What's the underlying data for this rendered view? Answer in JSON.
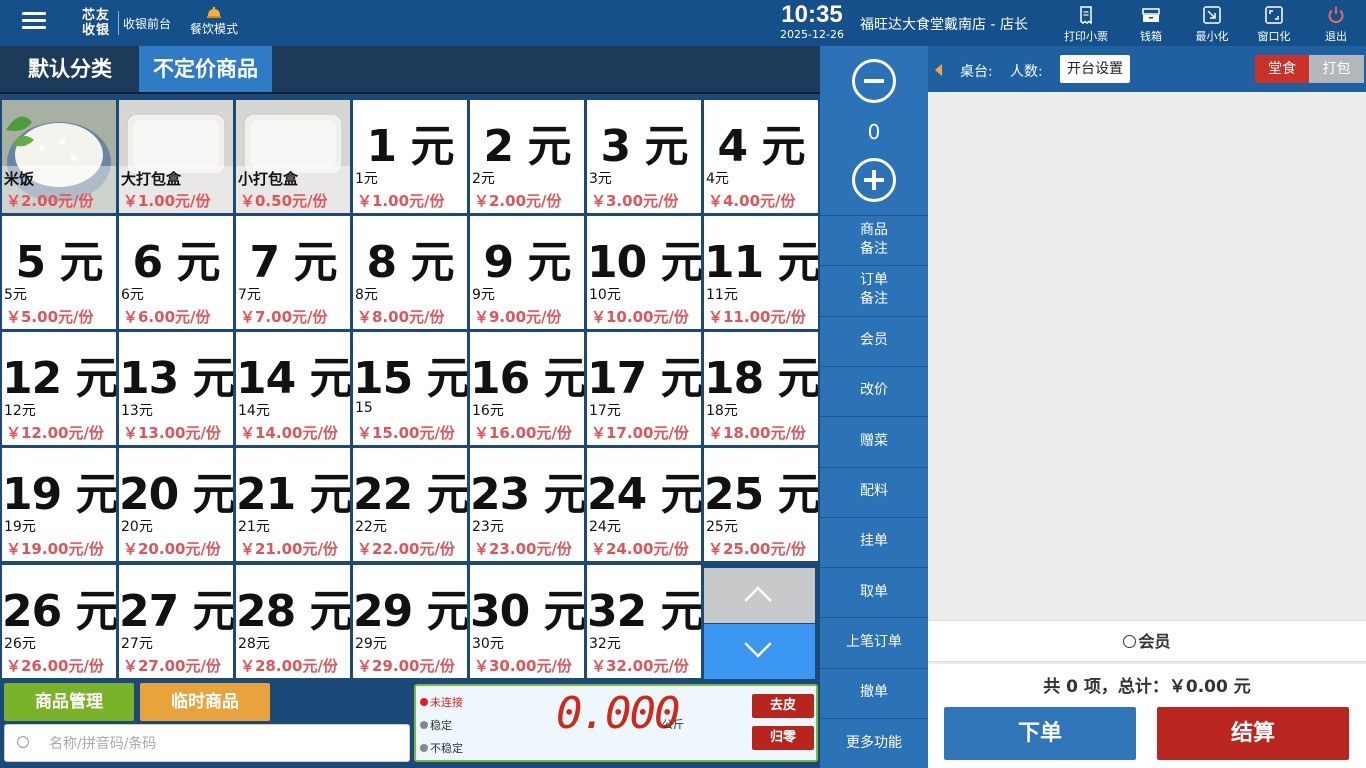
{
  "topbar": {
    "logo_line1": "芯友",
    "logo_line2": "收银",
    "logo_sub": "收银前台",
    "mode_label": "餐饮模式",
    "time": "10:35",
    "date": "2025-12-26",
    "store_name": "福旺达大食堂戴南店 - 店长",
    "buttons": [
      {
        "label": "打印小票",
        "icon": "receipt-icon"
      },
      {
        "label": "钱箱",
        "icon": "cash-drawer-icon"
      },
      {
        "label": "最小化",
        "icon": "minimize-icon"
      },
      {
        "label": "窗口化",
        "icon": "window-icon"
      },
      {
        "label": "退出",
        "icon": "power-icon"
      }
    ]
  },
  "categories": [
    {
      "label": "默认分类",
      "active": false
    },
    {
      "label": "不定价商品",
      "active": true
    }
  ],
  "products": [
    {
      "big": "",
      "name": "米饭",
      "price": "￥2.00元/份",
      "photo": "rice"
    },
    {
      "big": "",
      "name": "大打包盒",
      "price": "￥1.00元/份",
      "photo": "box"
    },
    {
      "big": "",
      "name": "小打包盒",
      "price": "￥0.50元/份",
      "photo": "box"
    },
    {
      "big": "1 元",
      "name": "1元",
      "price": "￥1.00元/份"
    },
    {
      "big": "2 元",
      "name": "2元",
      "price": "￥2.00元/份"
    },
    {
      "big": "3 元",
      "name": "3元",
      "price": "￥3.00元/份"
    },
    {
      "big": "4 元",
      "name": "4元",
      "price": "￥4.00元/份"
    },
    {
      "big": "5 元",
      "name": "5元",
      "price": "￥5.00元/份"
    },
    {
      "big": "6 元",
      "name": "6元",
      "price": "￥6.00元/份"
    },
    {
      "big": "7 元",
      "name": "7元",
      "price": "￥7.00元/份"
    },
    {
      "big": "8 元",
      "name": "8元",
      "price": "￥8.00元/份"
    },
    {
      "big": "9 元",
      "name": "9元",
      "price": "￥9.00元/份"
    },
    {
      "big": "10 元",
      "name": "10元",
      "price": "￥10.00元/份"
    },
    {
      "big": "11 元",
      "name": "11元",
      "price": "￥11.00元/份"
    },
    {
      "big": "12 元",
      "name": "12元",
      "price": "￥12.00元/份"
    },
    {
      "big": "13 元",
      "name": "13元",
      "price": "￥13.00元/份"
    },
    {
      "big": "14 元",
      "name": "14元",
      "price": "￥14.00元/份"
    },
    {
      "big": "15 元",
      "name": "15",
      "price": "￥15.00元/份"
    },
    {
      "big": "16 元",
      "name": "16元",
      "price": "￥16.00元/份"
    },
    {
      "big": "17 元",
      "name": "17元",
      "price": "￥17.00元/份"
    },
    {
      "big": "18 元",
      "name": "18元",
      "price": "￥18.00元/份"
    },
    {
      "big": "19 元",
      "name": "19元",
      "price": "￥19.00元/份"
    },
    {
      "big": "20 元",
      "name": "20元",
      "price": "￥20.00元/份"
    },
    {
      "big": "21 元",
      "name": "21元",
      "price": "￥21.00元/份"
    },
    {
      "big": "22 元",
      "name": "22元",
      "price": "￥22.00元/份"
    },
    {
      "big": "23 元",
      "name": "23元",
      "price": "￥23.00元/份"
    },
    {
      "big": "24 元",
      "name": "24元",
      "price": "￥24.00元/份"
    },
    {
      "big": "25 元",
      "name": "25元",
      "price": "￥25.00元/份"
    },
    {
      "big": "26 元",
      "name": "26元",
      "price": "￥26.00元/份"
    },
    {
      "big": "27 元",
      "name": "27元",
      "price": "￥27.00元/份"
    },
    {
      "big": "28 元",
      "name": "28元",
      "price": "￥28.00元/份"
    },
    {
      "big": "29 元",
      "name": "29元",
      "price": "￥29.00元/份"
    },
    {
      "big": "30 元",
      "name": "30元",
      "price": "￥30.00元/份"
    },
    {
      "big": "32 元",
      "name": "32元",
      "price": "￥32.00元/份"
    }
  ],
  "pager": {
    "up_icon": "chevron-up-icon",
    "down_icon": "chevron-down-icon"
  },
  "bottom": {
    "goods_mgmt": "商品管理",
    "temp_goods": "临时商品",
    "search_placeholder": "名称/拼音码/条码"
  },
  "scale": {
    "status_disconnected": "未连接",
    "status_stable": "稳定",
    "status_unstable": "不稳定",
    "weight": "0.000",
    "unit": "公斤",
    "tare": "去皮",
    "zero": "归零",
    "colors": {
      "disconnected": "#e02020",
      "stable": "#888888",
      "unstable": "#888888"
    }
  },
  "actions": {
    "qty": "0",
    "items": [
      "商品\n备注",
      "订单\n备注",
      "会员",
      "改价",
      "赠菜",
      "配料",
      "挂单",
      "取单",
      "上笔订单",
      "撤单",
      "更多功能"
    ]
  },
  "order": {
    "table_label": "桌台:",
    "people_label": "人数:",
    "open_table": "开台设置",
    "dine_in": "堂食",
    "takeout": "打包",
    "member_search": "会员",
    "summary": "共 0 项，总计：￥0.00 元",
    "place_order": "下单",
    "checkout": "结算"
  }
}
